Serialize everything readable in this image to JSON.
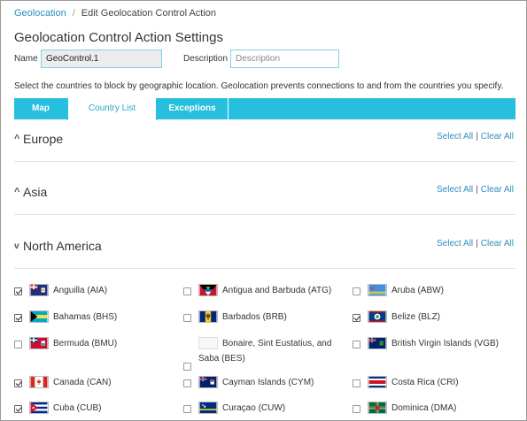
{
  "breadcrumb": {
    "parent": "Geolocation",
    "separator": "/",
    "current": "Edit Geolocation Control Action"
  },
  "page_title": "Geolocation Control Action Settings",
  "form": {
    "name_label": "Name",
    "name_value": "GeoControl.1",
    "description_label": "Description",
    "description_placeholder": "Description"
  },
  "intro_text": "Select the countries to block by geographic location. Geolocation prevents connections to and from the countries you specify.",
  "tabs": [
    {
      "label": "Map",
      "active": false
    },
    {
      "label": "Country List",
      "active": true
    },
    {
      "label": "Exceptions",
      "active": false
    }
  ],
  "region_actions": {
    "select_all": "Select All",
    "separator": "|",
    "clear_all": "Clear All"
  },
  "regions": [
    {
      "name": "Europe",
      "expanded": false,
      "chevron": "^"
    },
    {
      "name": "Asia",
      "expanded": false,
      "chevron": "^"
    },
    {
      "name": "North America",
      "expanded": true,
      "chevron": "v"
    }
  ],
  "countries": [
    {
      "label": "Anguilla (AIA)",
      "checked": true,
      "flag": "anguilla-flag-icon"
    },
    {
      "label": "Antigua and Barbuda (ATG)",
      "checked": false,
      "flag": "antigua-barbuda-flag-icon"
    },
    {
      "label": "Aruba (ABW)",
      "checked": false,
      "flag": "aruba-flag-icon"
    },
    {
      "label": "Bahamas (BHS)",
      "checked": true,
      "flag": "bahamas-flag-icon"
    },
    {
      "label": "Barbados (BRB)",
      "checked": false,
      "flag": "barbados-flag-icon"
    },
    {
      "label": "Belize (BLZ)",
      "checked": true,
      "flag": "belize-flag-icon"
    },
    {
      "label": "Bermuda (BMU)",
      "checked": false,
      "flag": "bermuda-flag-icon"
    },
    {
      "label_line1": "Bonaire, Sint Eustatius, and",
      "label_line2": "Saba (BES)",
      "checked": false,
      "flag": "bonaire-flag-icon"
    },
    {
      "label": "British Virgin Islands (VGB)",
      "checked": false,
      "flag": "british-virgin-islands-flag-icon"
    },
    {
      "label": "Canada (CAN)",
      "checked": true,
      "flag": "canada-flag-icon"
    },
    {
      "label": "Cayman Islands (CYM)",
      "checked": false,
      "flag": "cayman-islands-flag-icon"
    },
    {
      "label": "Costa Rica (CRI)",
      "checked": false,
      "flag": "costa-rica-flag-icon"
    },
    {
      "label": "Cuba (CUB)",
      "checked": true,
      "flag": "cuba-flag-icon"
    },
    {
      "label": "Curaçao (CUW)",
      "checked": false,
      "flag": "curacao-flag-icon"
    },
    {
      "label": "Dominica (DMA)",
      "checked": false,
      "flag": "dominica-flag-icon"
    }
  ],
  "colors": {
    "accent": "#26bfdd",
    "link": "#2c8fbf",
    "input_border": "#7fd0e4"
  }
}
